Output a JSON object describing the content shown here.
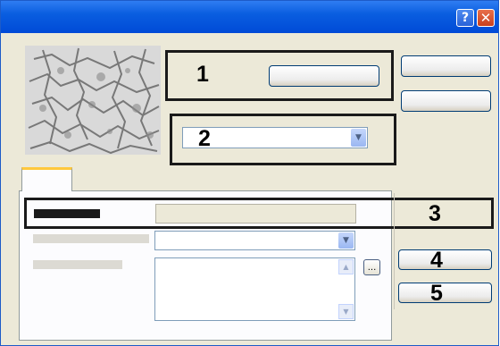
{
  "window": {
    "help_glyph": "?",
    "close_glyph": "✕"
  },
  "callouts": {
    "one": "1",
    "two": "2",
    "three": "3",
    "four": "4",
    "five": "5"
  },
  "browse_button_label": "...",
  "colors": {
    "titlebar": "#0a5ee0",
    "dialog_bg": "#ece9d8",
    "tab_highlight": "#ffc83c",
    "callout_border": "#1a1a1a"
  }
}
